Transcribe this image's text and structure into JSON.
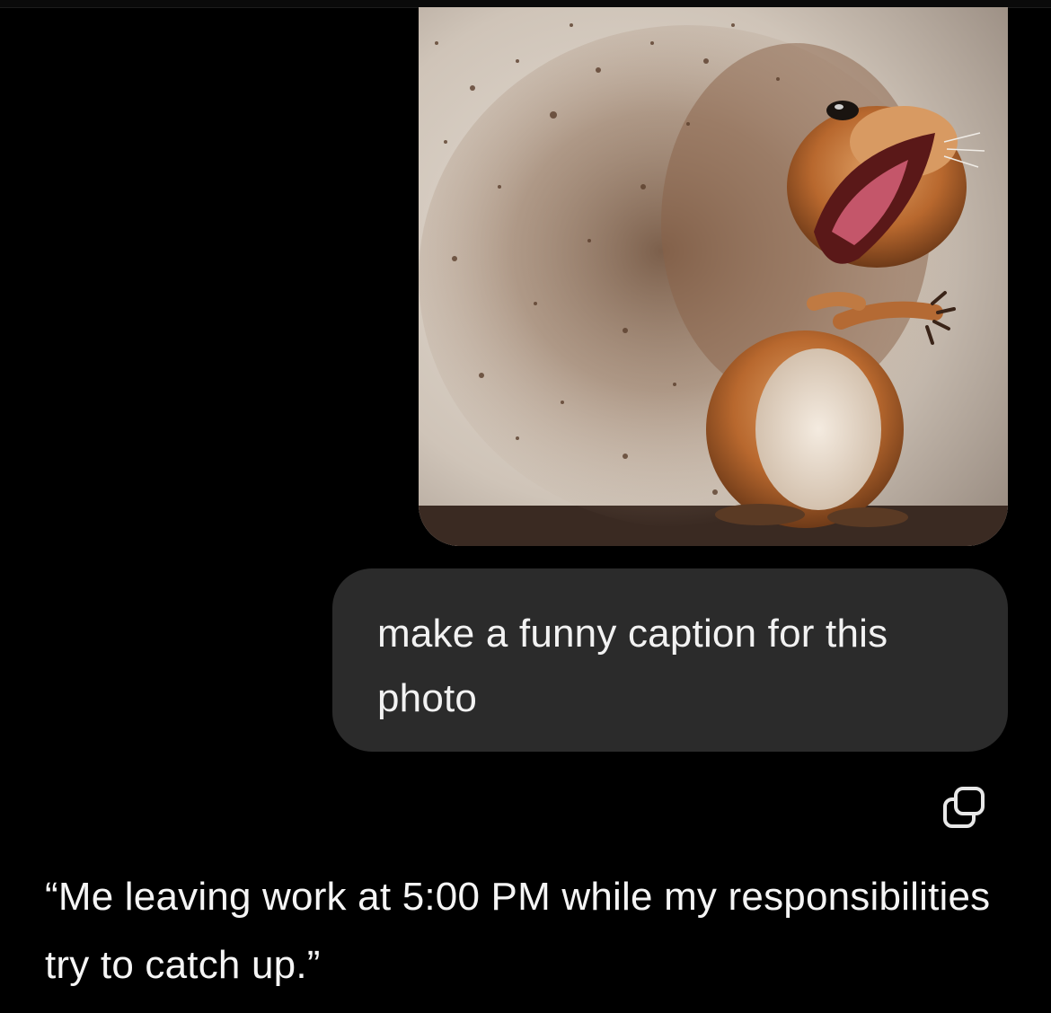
{
  "conversation": {
    "user_message": {
      "attachment_icon": "squirrel-photo",
      "text": "make a funny caption for this photo"
    },
    "actions": {
      "copy_icon": "copy-icon"
    },
    "assistant_reply": {
      "text": "“Me leaving work at 5:00 PM while my responsibilities try to catch up.”"
    }
  },
  "colors": {
    "background": "#000000",
    "user_bubble": "#2b2b2b",
    "text": "#f5f5f5"
  }
}
